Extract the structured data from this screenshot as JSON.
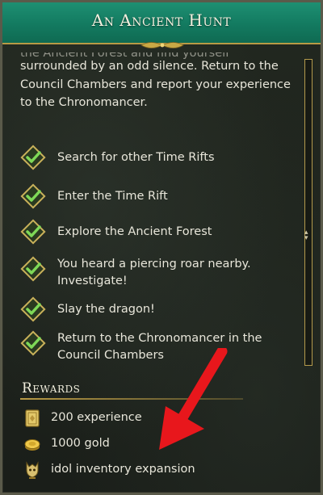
{
  "header": {
    "title": "An Ancient Hunt"
  },
  "description": {
    "clipped_line": "the Ancient Forest and find yourself",
    "lines": [
      "surrounded by an odd silence. Return to the",
      "Council Chambers and report your experience",
      "to the Chronomancer."
    ]
  },
  "objectives": [
    {
      "lines": [
        "Search for other Time Rifts"
      ],
      "completed": true
    },
    {
      "lines": [
        "Enter the Time Rift"
      ],
      "completed": true
    },
    {
      "lines": [
        "Explore the Ancient Forest"
      ],
      "completed": true
    },
    {
      "lines": [
        "You heard a piercing roar nearby.",
        "Investigate!"
      ],
      "completed": true
    },
    {
      "lines": [
        "Slay the dragon!"
      ],
      "completed": true
    },
    {
      "lines": [
        "Return to the Chronomancer in the",
        "Council Chambers"
      ],
      "completed": true
    }
  ],
  "rewards": {
    "title": "Rewards",
    "items": [
      {
        "label": "200 experience",
        "icon": "experience-tome-icon"
      },
      {
        "label": "1000 gold",
        "icon": "gold-coin-icon"
      },
      {
        "label": "idol inventory expansion",
        "icon": "idol-icon"
      }
    ]
  },
  "colors": {
    "header": "#137a60",
    "accent_gold": "#b89a45",
    "check_green": "#58c84a",
    "arrow_red": "#e8171c"
  }
}
